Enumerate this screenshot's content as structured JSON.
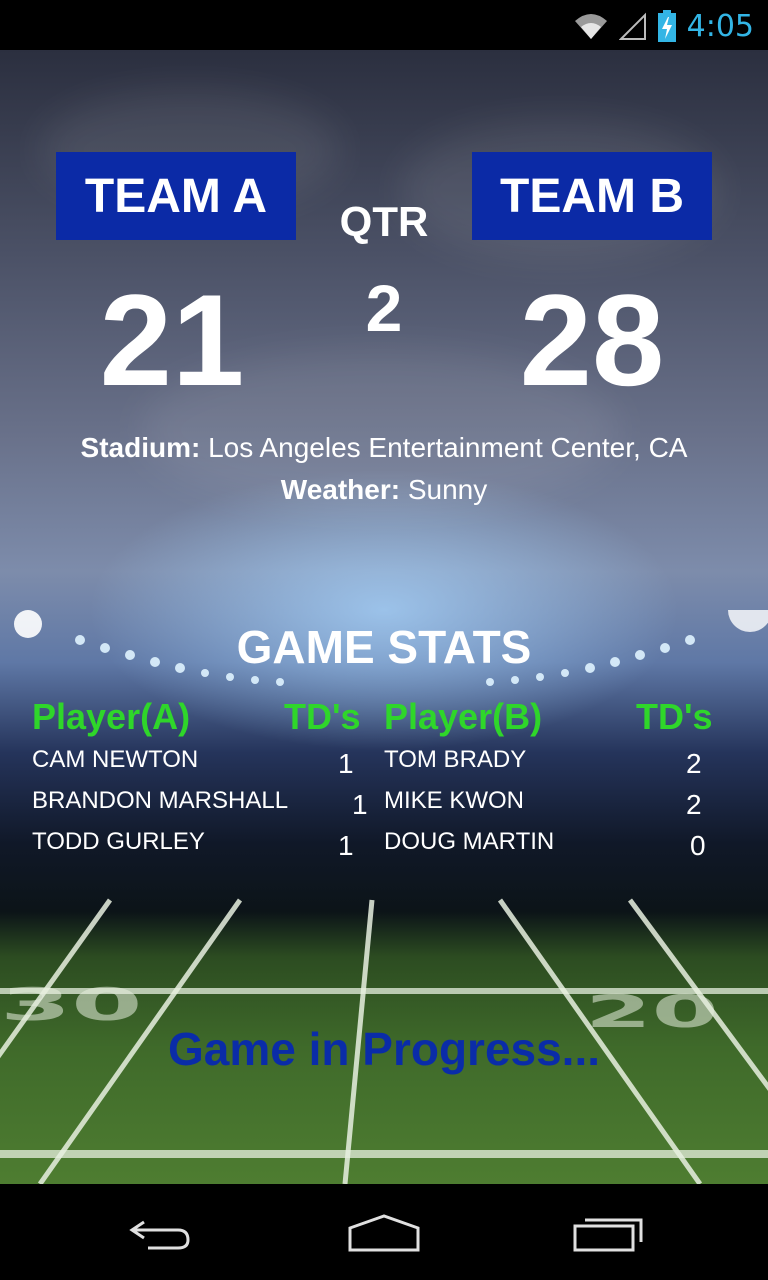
{
  "status_bar": {
    "time": "4:05",
    "icons": [
      "wifi-icon",
      "signal-icon",
      "battery-icon"
    ]
  },
  "scoreboard": {
    "team_a": {
      "name": "TEAM A",
      "score": "21"
    },
    "team_b": {
      "name": "TEAM B",
      "score": "28"
    },
    "qtr_label": "QTR",
    "qtr_value": "2"
  },
  "info": {
    "stadium_label": "Stadium:",
    "stadium_value": " Los Angeles Entertainment Center, CA",
    "weather_label": "Weather:",
    "weather_value": " Sunny"
  },
  "stats": {
    "title": "GAME STATS",
    "headers": {
      "player_a": "Player(A)",
      "td_a": "TD's",
      "player_b": "Player(B)",
      "td_b": "TD's"
    },
    "team_a_rows": [
      {
        "name": "CAM NEWTON",
        "tds": "1"
      },
      {
        "name": "BRANDON MARSHALL",
        "tds": "1"
      },
      {
        "name": "TODD GURLEY",
        "tds": "1"
      }
    ],
    "team_b_rows": [
      {
        "name": "TOM BRADY",
        "tds": "2"
      },
      {
        "name": "MIKE KWON",
        "tds": "2"
      },
      {
        "name": "DOUG MARTIN",
        "tds": "0"
      }
    ]
  },
  "status_message": "Game in Progress...",
  "colors": {
    "team_box": "#0b2aa6",
    "header_green": "#2fd62a",
    "clock_blue": "#33b5e5",
    "progress_blue": "#0a2ca8"
  },
  "nav": {
    "icons": [
      "back-icon",
      "home-icon",
      "recent-apps-icon"
    ]
  }
}
